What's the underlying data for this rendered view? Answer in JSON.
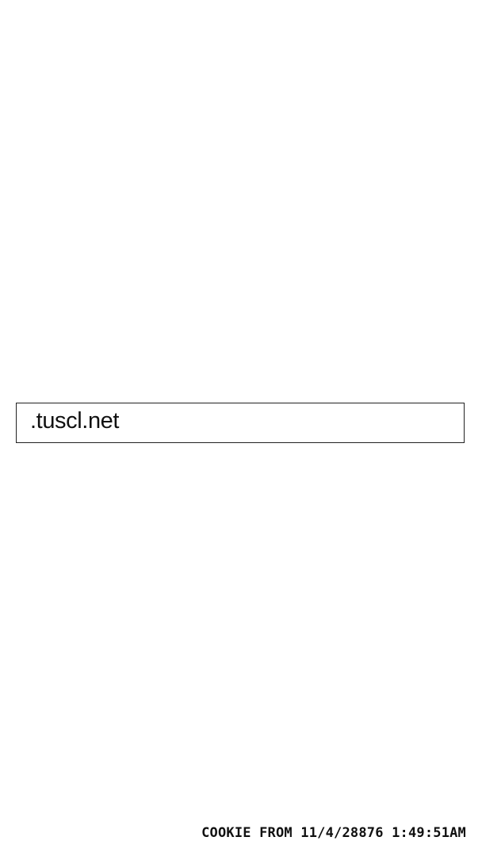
{
  "domain": {
    "text": ".tuscl.net"
  },
  "footer": {
    "cookie_label": "COOKIE FROM 11/4/28876 1:49:51AM"
  },
  "colors": {
    "background": "#ffffff",
    "text": "#111111",
    "border": "#222222"
  }
}
